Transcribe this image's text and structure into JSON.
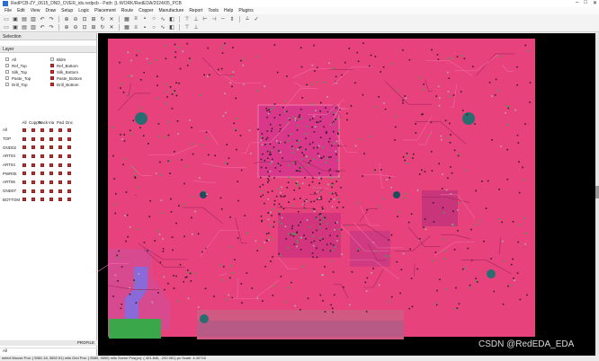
{
  "window": {
    "title": "RedPCB-ZY_0615_DND_OVER_idx.redpcb  -  Path: [L:WORK/RedEDA/2024/05_PCB",
    "controls": [
      "–",
      "□",
      "✕"
    ]
  },
  "menu": [
    "File",
    "Edit",
    "View",
    "Draw",
    "Setup",
    "Logic",
    "Placement",
    "Route",
    "Copper",
    "Manufacture",
    "Report",
    "Tools",
    "Help",
    "Plugins"
  ],
  "toolbar_icons": [
    "new-icon",
    "open-icon",
    "save-icon",
    "print-icon",
    "undo-icon",
    "redo-icon",
    "zoom-in-icon",
    "zoom-out-icon",
    "zoom-fit-icon",
    "zoom-area-icon",
    "refresh-icon",
    "delete-icon",
    "grid-icon",
    "layer-icon",
    "pad-icon",
    "via-icon",
    "route-icon",
    "copper-icon",
    "align-left-icon",
    "align-right-icon",
    "align-top-icon",
    "align-bottom-icon",
    "distribute-h-icon",
    "distribute-v-icon",
    "measure-icon",
    "drc-icon"
  ],
  "toolbar2_icons": [
    "line-icon",
    "arc-icon",
    "rect-icon",
    "circle-icon",
    "polygon-icon",
    "text-icon",
    "dimension-icon",
    "select-icon",
    "move-icon",
    "rotate-icon",
    "mirror-icon",
    "copy-icon",
    "paste-icon",
    "array-icon",
    "eye-icon",
    "lock-icon",
    "highlight-icon",
    "net-icon",
    "dim-icon",
    "3d-icon"
  ],
  "left": {
    "selection_title": "Selection",
    "layer_title": "Layer",
    "layers": [
      {
        "label": "All",
        "on": false
      },
      {
        "label": "Bldm",
        "on": false
      },
      {
        "label": "Ref_Top",
        "on": false
      },
      {
        "label": "Ref_Bottom",
        "on": true
      },
      {
        "label": "Silk_Top",
        "on": false
      },
      {
        "label": "Silk_Bottom",
        "on": true
      },
      {
        "label": "Paste_Top",
        "on": false
      },
      {
        "label": "Paste_Bottom",
        "on": true
      },
      {
        "label": "Drill_Top",
        "on": false
      },
      {
        "label": "Drill_Bottom",
        "on": true
      }
    ],
    "table_headers": [
      "All",
      "Copper",
      "Track",
      "Via",
      "Pad",
      "Dnc"
    ],
    "table_rows": [
      "All",
      "TOP",
      "GND02",
      "ART03",
      "ART04",
      "PWR05",
      "ART06",
      "GND07",
      "BOTTOM"
    ],
    "profile_title": "PROFILE",
    "all_label": "All"
  },
  "status": "select   Mouse Pos: ( 5581.18, 3652.51) mils  Grid Pos: ( 5580, 3650) mils  Scene Pos(px): ( 401.846, -292.981) px  Scale: 4.40716",
  "watermark": "CSDN @RedEDA_EDA",
  "colors": {
    "board": "#e8427c",
    "canvas_bg": "#000000",
    "copper_green": "#3aa84a",
    "via_teal": "#2a6d70",
    "pad_purple": "#8a6ad8"
  }
}
